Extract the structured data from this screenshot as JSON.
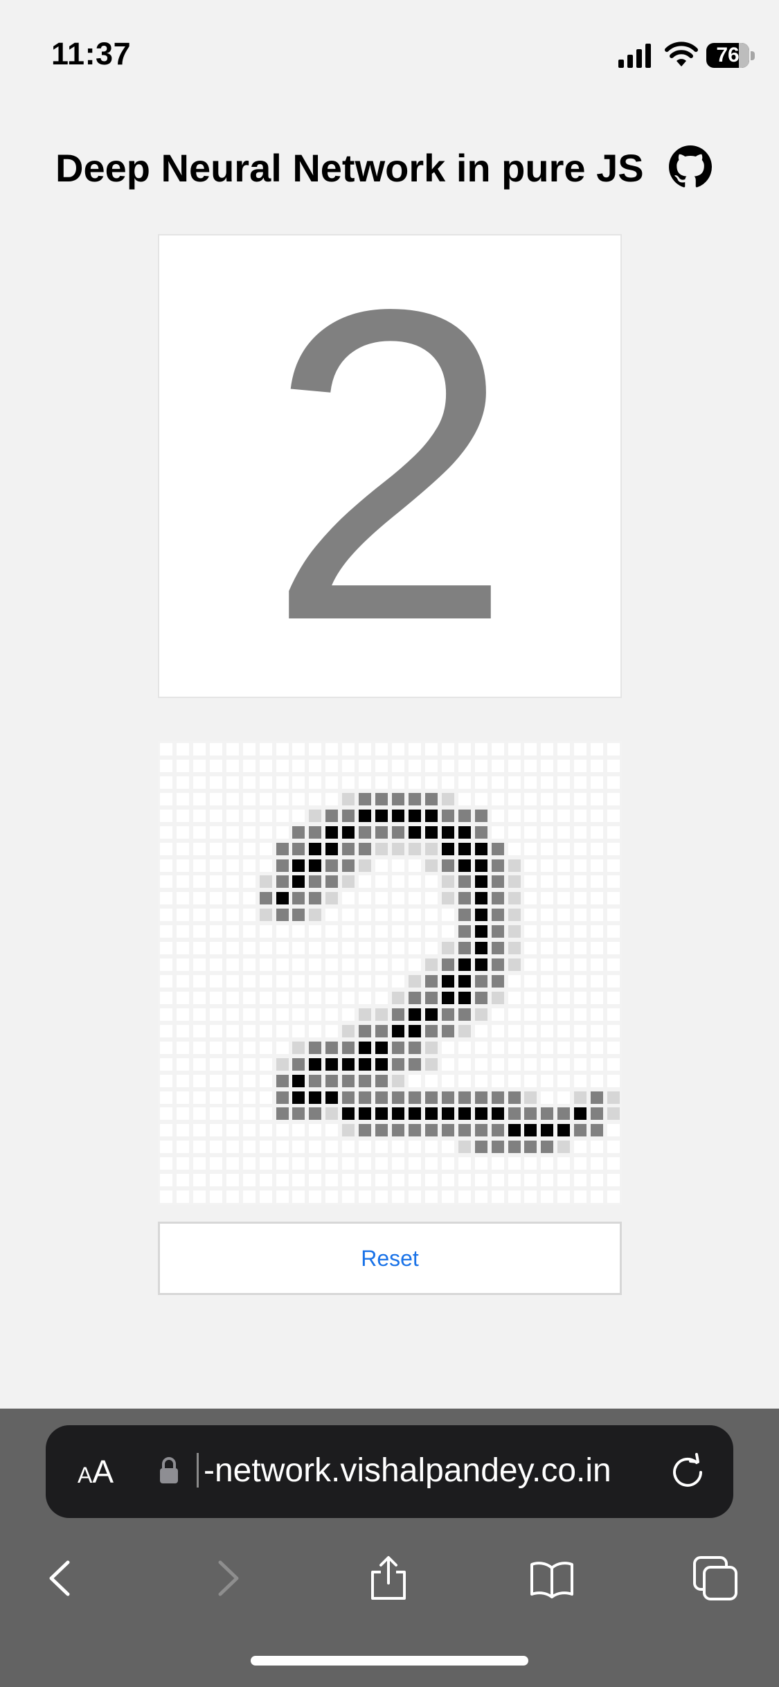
{
  "status": {
    "time": "11:37",
    "battery": "76",
    "battery_level": 0.76
  },
  "page": {
    "title": "Deep Neural Network in pure JS"
  },
  "prediction": {
    "digit": "2"
  },
  "grid": {
    "size": 28,
    "colors": {
      "empty": "#f3f3f3",
      "light": "#d6d6d6",
      "mid": "#808080",
      "dark": "#000000"
    },
    "rows": [
      "............................",
      "............................",
      "............................",
      "...........LMMMMML..........",
      ".........LMMDDDDDMMM........",
      "........MMDDMMMDDDDM........",
      ".......MMDDMMLLLLDDDM.......",
      ".......MDDMML...LMDDML......",
      "......LMDMML.....LMDML......",
      "......MDMML......LMDML......",
      "......LMML........MDML......",
      "..................MDML......",
      ".................LMDML......",
      "................LMDDML......",
      "...............LMDDMM.......",
      "..............LMMDDML.......",
      "............LLMDDMML........",
      "...........LMMDDMML.........",
      "........LMMMDDMML...........",
      ".......LMDDDDDMML...........",
      ".......MDMMMMML.............",
      ".......MDDDMMMMMMMMMMML..LML.",
      ".......MMMLDDDDDDDDDDMMMMDML.",
      "...........LMMMMMMMMMDDDDMM..",
      "..................LMMMMML....",
      "............................",
      "............................",
      "............................"
    ]
  },
  "reset": {
    "label": "Reset"
  },
  "browser": {
    "aa_large": "A",
    "aa_small": "A",
    "url": "-network.vishalpandey.co.in"
  }
}
